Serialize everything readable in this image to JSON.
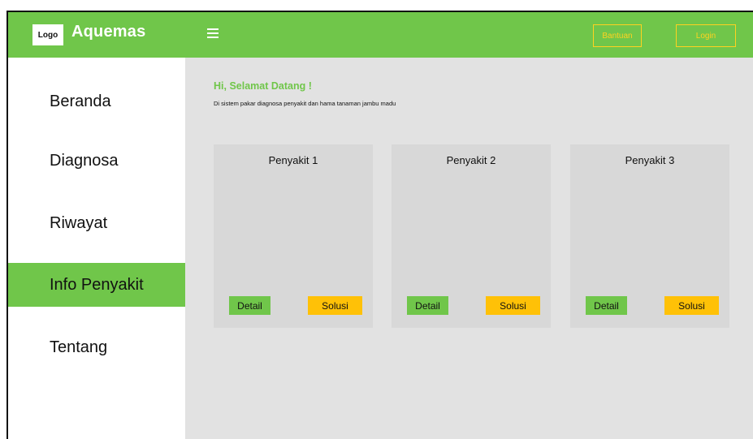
{
  "header": {
    "logo_label": "Logo",
    "brand": "Aquemas",
    "menu_icon": "hamburger-icon",
    "bantuan_label": "Bantuan",
    "login_label": "Login"
  },
  "sidebar": {
    "items": [
      {
        "label": "Beranda",
        "active": false
      },
      {
        "label": "Diagnosa",
        "active": false
      },
      {
        "label": "Riwayat",
        "active": false
      },
      {
        "label": "Info Penyakit",
        "active": true
      },
      {
        "label": "Tentang",
        "active": false
      }
    ]
  },
  "main": {
    "greeting": "Hi, Selamat Datang !",
    "subtitle": "Di sistem pakar diagnosa penyakit dan hama tanaman jambu madu",
    "cards": [
      {
        "title": "Penyakit 1",
        "detail_label": "Detail",
        "solusi_label": "Solusi"
      },
      {
        "title": "Penyakit 2",
        "detail_label": "Detail",
        "solusi_label": "Solusi"
      },
      {
        "title": "Penyakit 3",
        "detail_label": "Detail",
        "solusi_label": "Solusi"
      }
    ]
  },
  "colors": {
    "brand_green": "#70c64a",
    "accent_yellow": "#ffc107",
    "outline_yellow": "#ffd21f",
    "content_bg": "#e2e2e2",
    "card_bg": "#d8d8d8"
  }
}
